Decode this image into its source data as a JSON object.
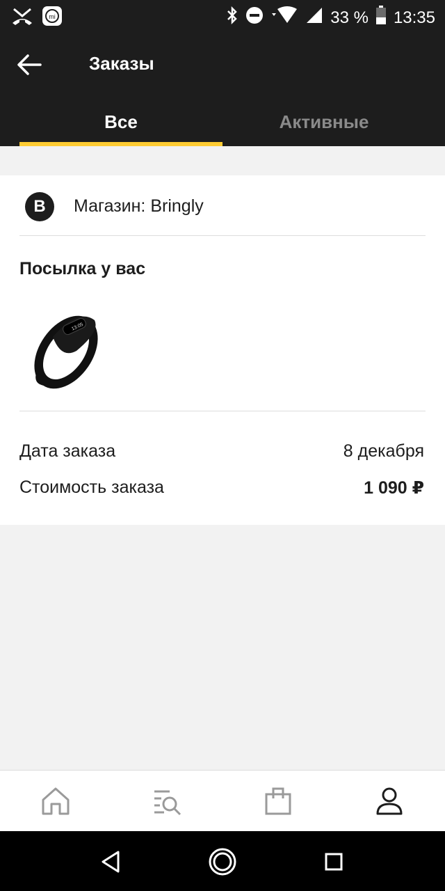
{
  "status_bar": {
    "battery": "33 %",
    "time": "13:35",
    "icons": [
      "missed-call-icon",
      "mi-icon",
      "bluetooth-icon",
      "dnd-icon",
      "wifi-icon",
      "signal-icon",
      "battery-icon"
    ]
  },
  "header": {
    "title": "Заказы",
    "tabs": [
      {
        "label": "Все",
        "selected": true
      },
      {
        "label": "Активные",
        "selected": false
      }
    ],
    "accent": "#ffcc33",
    "background": "#1d1d1d"
  },
  "order": {
    "store_logo_letter": "B",
    "store_label": "Магазин: Bringly",
    "status": "Посылка у вас",
    "product_icon": "fitness-band-image",
    "date_label": "Дата заказа",
    "date_value": "8 декабря",
    "cost_label": "Стоимость заказа",
    "cost_value": "1 090 ₽"
  },
  "bottom_nav": {
    "items": [
      {
        "icon": "home-icon",
        "selected": false
      },
      {
        "icon": "catalog-search-icon",
        "selected": false
      },
      {
        "icon": "shopping-bag-icon",
        "selected": false
      },
      {
        "icon": "profile-icon",
        "selected": true
      }
    ]
  },
  "system_nav": {
    "icons": [
      "back-triangle-icon",
      "home-circle-icon",
      "recents-square-icon"
    ]
  }
}
